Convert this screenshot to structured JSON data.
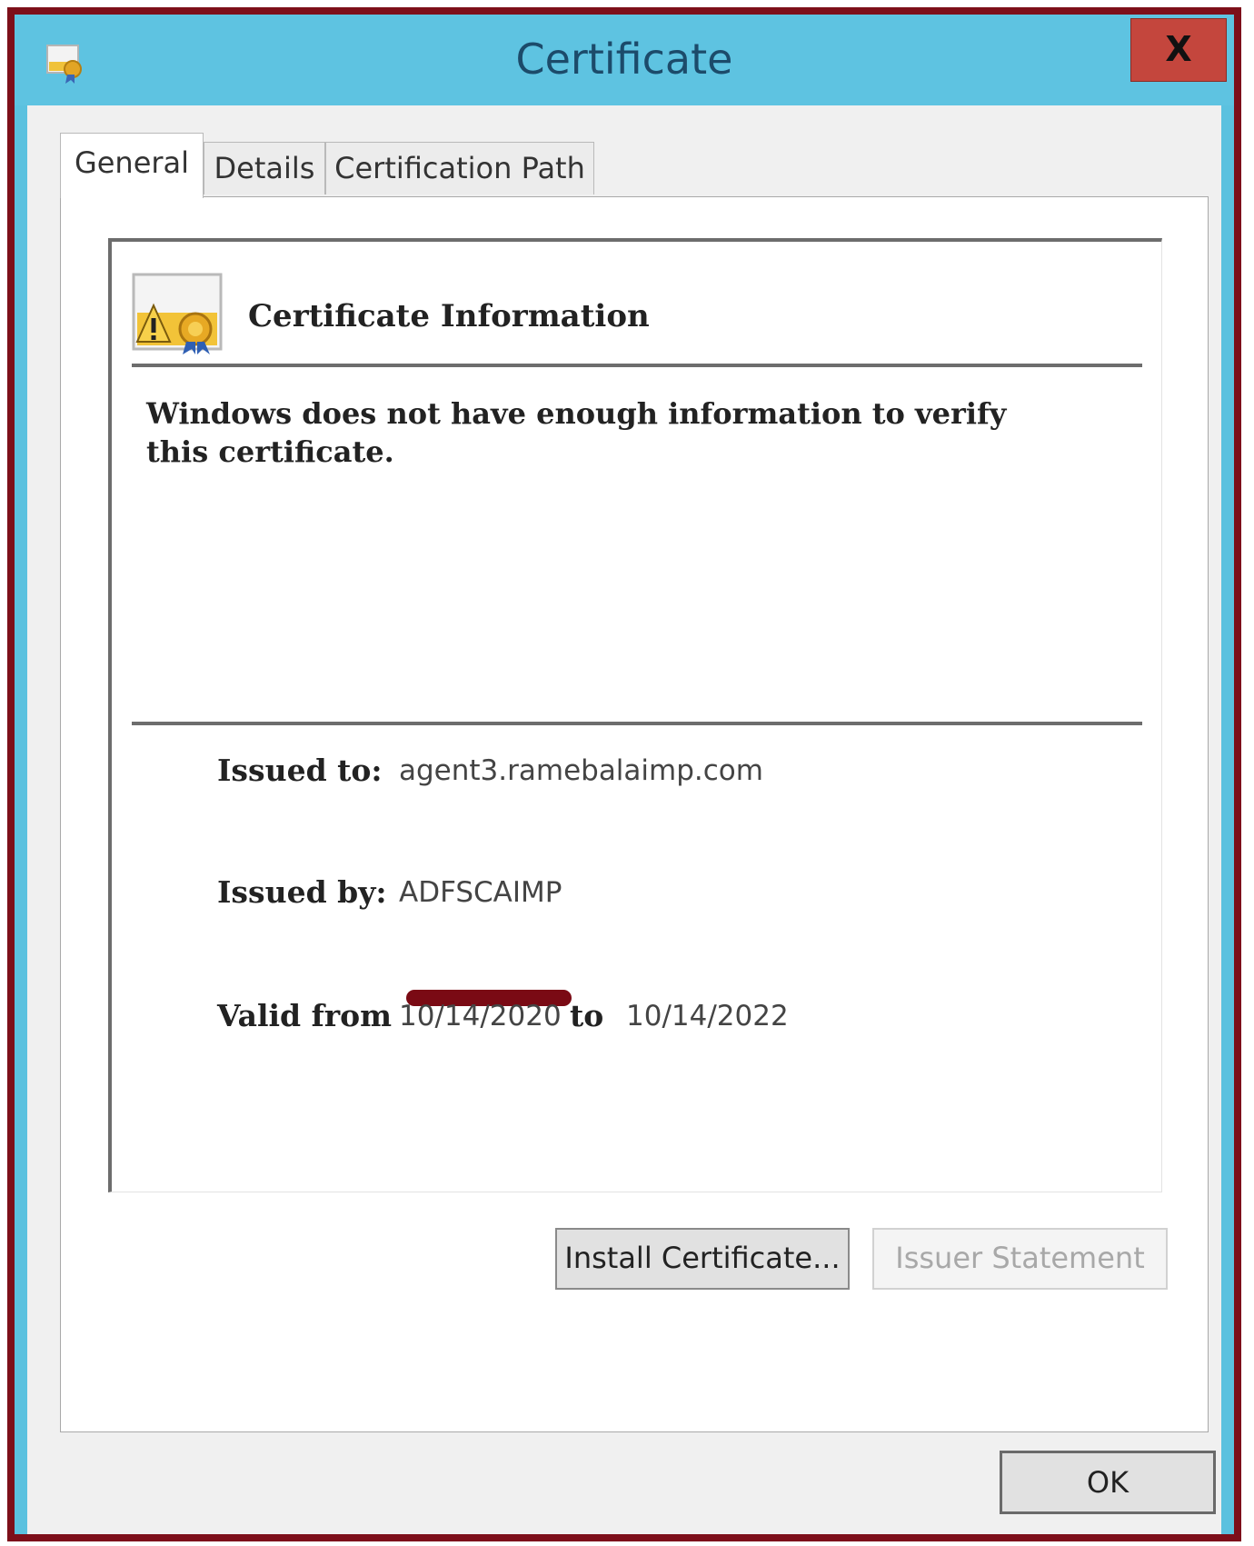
{
  "window": {
    "title": "Certificate",
    "close_label": "X"
  },
  "tabs": [
    {
      "label": "General",
      "selected": true
    },
    {
      "label": "Details",
      "selected": false
    },
    {
      "label": "Certification Path",
      "selected": false
    }
  ],
  "info": {
    "heading": "Certificate Information",
    "message": "Windows does not have enough information to verify this certificate."
  },
  "fields": {
    "issued_to_label": "Issued to:",
    "issued_to_value": "agent3.ramebalaimp.com",
    "issued_by_label": "Issued by:",
    "issued_by_value": "ADFSCAIMP",
    "valid_from_label": "Valid from",
    "valid_from_value": "10/14/2020",
    "valid_to_label": "to",
    "valid_to_value": "10/14/2022"
  },
  "buttons": {
    "install": "Install Certificate...",
    "issuer_statement": "Issuer Statement",
    "ok": "OK"
  },
  "colors": {
    "titlebar": "#5ec3e1",
    "frame": "#7d0f1a",
    "close_button": "#c4463d",
    "annotation_underline": "#7a0a14"
  }
}
